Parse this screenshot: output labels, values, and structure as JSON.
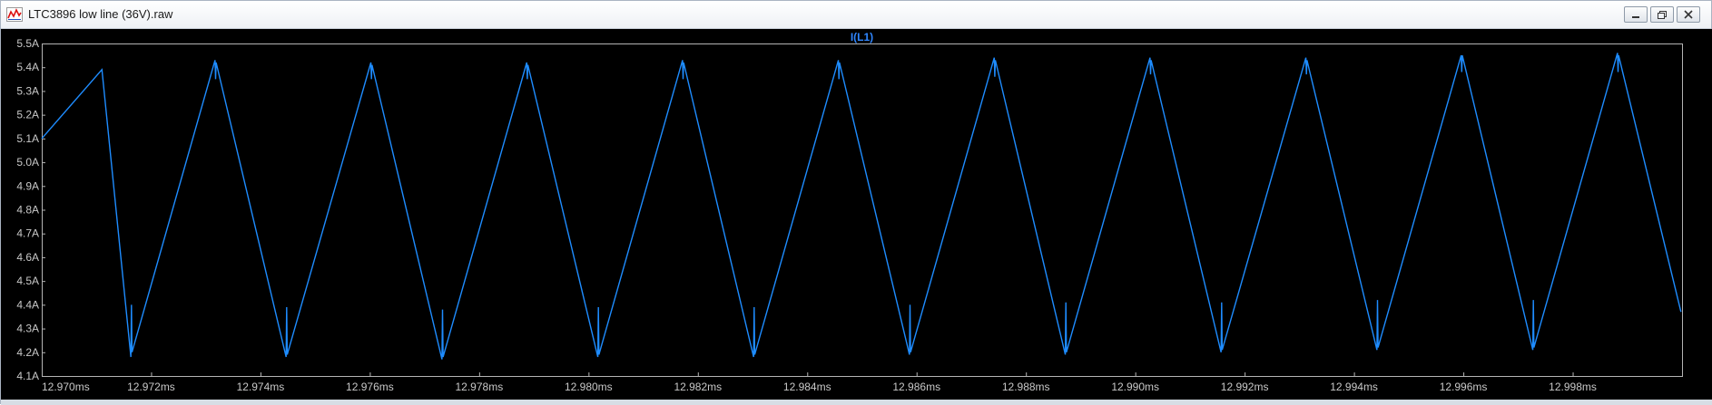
{
  "window": {
    "title": "LTC3896 low line (36V).raw",
    "icon": "waveform-app-icon",
    "buttons": [
      "minimize-icon",
      "restore-icon",
      "close-icon"
    ]
  },
  "colors": {
    "background": "#000000",
    "frame": "#b4b4b4",
    "labels": "#c8c8c8",
    "trace": "#1e8cff",
    "trace_label": "#2f86ff"
  },
  "chart_data": {
    "type": "line",
    "title": "",
    "series": [
      {
        "name": "I(L1)",
        "x_unit": "ms",
        "y_unit": "A",
        "x": [
          12.97,
          12.9711,
          12.97163,
          12.97164,
          12.97165,
          12.97317,
          12.97318,
          12.97319,
          12.97447,
          12.97448,
          12.97449,
          12.97602,
          12.97603,
          12.97604,
          12.97732,
          12.97733,
          12.97734,
          12.97887,
          12.97888,
          12.97889,
          12.98017,
          12.98018,
          12.98019,
          12.98172,
          12.98173,
          12.98174,
          12.98302,
          12.98303,
          12.98304,
          12.98457,
          12.98458,
          12.98459,
          12.98587,
          12.98588,
          12.98589,
          12.98742,
          12.98743,
          12.98744,
          12.98872,
          12.98873,
          12.98874,
          12.99027,
          12.99028,
          12.99029,
          12.99157,
          12.99158,
          12.99159,
          12.99312,
          12.99313,
          12.99314,
          12.99442,
          12.99443,
          12.99444,
          12.99596,
          12.99597,
          12.99598,
          12.99727,
          12.99728,
          12.99729,
          12.99882,
          12.99883,
          12.99884,
          12.99998
        ],
        "y": [
          5.1,
          5.39,
          4.18,
          4.4,
          4.2,
          5.43,
          5.35,
          5.42,
          4.18,
          4.39,
          4.19,
          5.42,
          5.35,
          5.41,
          4.17,
          4.38,
          4.18,
          5.42,
          5.35,
          5.41,
          4.18,
          4.39,
          4.19,
          5.43,
          5.35,
          5.42,
          4.18,
          4.39,
          4.19,
          5.43,
          5.35,
          5.42,
          4.19,
          4.4,
          4.2,
          5.44,
          5.36,
          5.43,
          4.19,
          4.41,
          4.2,
          5.44,
          5.37,
          5.43,
          4.2,
          4.41,
          4.21,
          5.44,
          5.37,
          5.43,
          4.21,
          4.42,
          4.22,
          5.45,
          5.38,
          5.45,
          4.21,
          4.42,
          4.22,
          5.46,
          5.38,
          5.45,
          4.37
        ]
      }
    ],
    "xlim": [
      12.97,
      13.0
    ],
    "ylim": [
      4.1,
      5.5
    ],
    "x_ticks": [
      {
        "value": 12.97,
        "label": "12.970ms"
      },
      {
        "value": 12.972,
        "label": "12.972ms"
      },
      {
        "value": 12.974,
        "label": "12.974ms"
      },
      {
        "value": 12.976,
        "label": "12.976ms"
      },
      {
        "value": 12.978,
        "label": "12.978ms"
      },
      {
        "value": 12.98,
        "label": "12.980ms"
      },
      {
        "value": 12.982,
        "label": "12.982ms"
      },
      {
        "value": 12.984,
        "label": "12.984ms"
      },
      {
        "value": 12.986,
        "label": "12.986ms"
      },
      {
        "value": 12.988,
        "label": "12.988ms"
      },
      {
        "value": 12.99,
        "label": "12.990ms"
      },
      {
        "value": 12.992,
        "label": "12.992ms"
      },
      {
        "value": 12.994,
        "label": "12.994ms"
      },
      {
        "value": 12.996,
        "label": "12.996ms"
      },
      {
        "value": 12.998,
        "label": "12.998ms"
      }
    ],
    "y_ticks": [
      {
        "value": 5.5,
        "label": "5.5A"
      },
      {
        "value": 5.4,
        "label": "5.4A"
      },
      {
        "value": 5.3,
        "label": "5.3A"
      },
      {
        "value": 5.2,
        "label": "5.2A"
      },
      {
        "value": 5.1,
        "label": "5.1A"
      },
      {
        "value": 5.0,
        "label": "5.0A"
      },
      {
        "value": 4.9,
        "label": "4.9A"
      },
      {
        "value": 4.8,
        "label": "4.8A"
      },
      {
        "value": 4.7,
        "label": "4.7A"
      },
      {
        "value": 4.6,
        "label": "4.6A"
      },
      {
        "value": 4.5,
        "label": "4.5A"
      },
      {
        "value": 4.4,
        "label": "4.4A"
      },
      {
        "value": 4.3,
        "label": "4.3A"
      },
      {
        "value": 4.2,
        "label": "4.2A"
      },
      {
        "value": 4.1,
        "label": "4.1A"
      }
    ],
    "grid": false,
    "legend": "top-center"
  }
}
